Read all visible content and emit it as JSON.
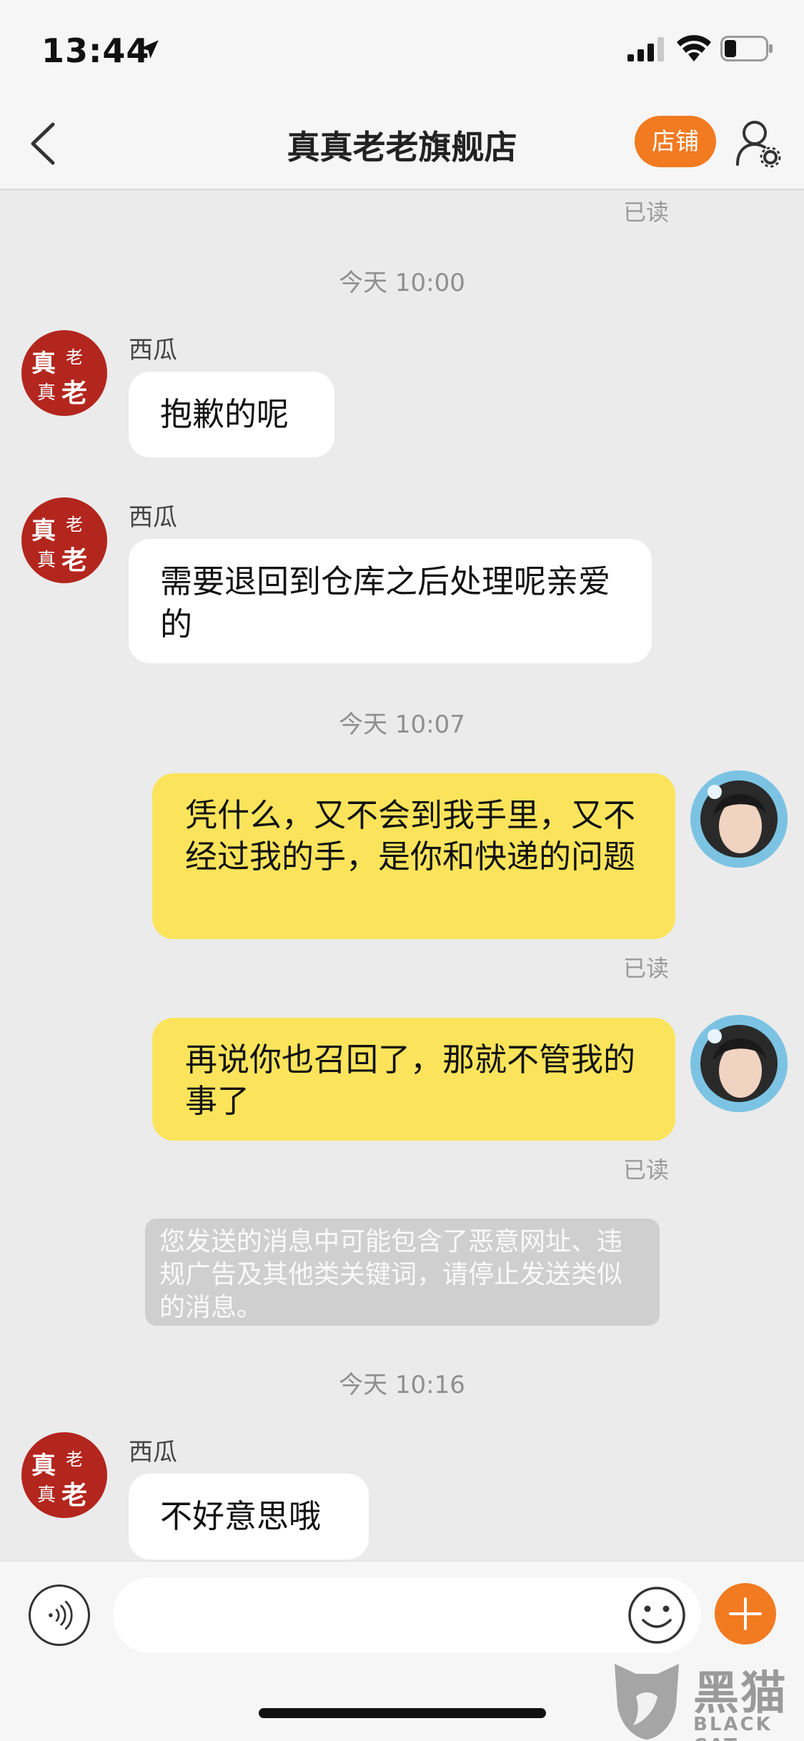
{
  "status_bar": {
    "time": "13:44"
  },
  "nav": {
    "title": "真真老老旗舰店",
    "shop_button": "店铺"
  },
  "chat": {
    "read_label": "已读",
    "sender_name": "西瓜",
    "timestamps": [
      "今天 10:00",
      "今天 10:07",
      "今天 10:16"
    ],
    "messages": [
      {
        "text": "抱歉的呢"
      },
      {
        "text": "需要退回到仓库之后处理呢亲爱的"
      },
      {
        "text": "凭什么，又不会到我手里，又不经过我的手，是你和快递的问题"
      },
      {
        "text": "再说你也召回了，那就不管我的事了"
      },
      {
        "text": "不好意思哦"
      }
    ],
    "system_notice": "您发送的消息中可能包含了恶意网址、违规广告及其他类关键词，请停止发送类似的消息。"
  },
  "input": {
    "placeholder": ""
  },
  "watermark": {
    "brand": "黑猫",
    "sub": "BLACK CAT"
  },
  "avatar_shop_text": "真老真老",
  "colors": {
    "accent": "#f27a21",
    "out_bubble": "#fbe45b",
    "in_bubble": "#ffffff",
    "background": "#ebebeb"
  },
  "icons": [
    "location-arrow-icon",
    "signal-icon",
    "wifi-icon",
    "battery-icon",
    "back-chevron-icon",
    "user-settings-icon",
    "voice-icon",
    "emoji-icon",
    "plus-icon"
  ]
}
